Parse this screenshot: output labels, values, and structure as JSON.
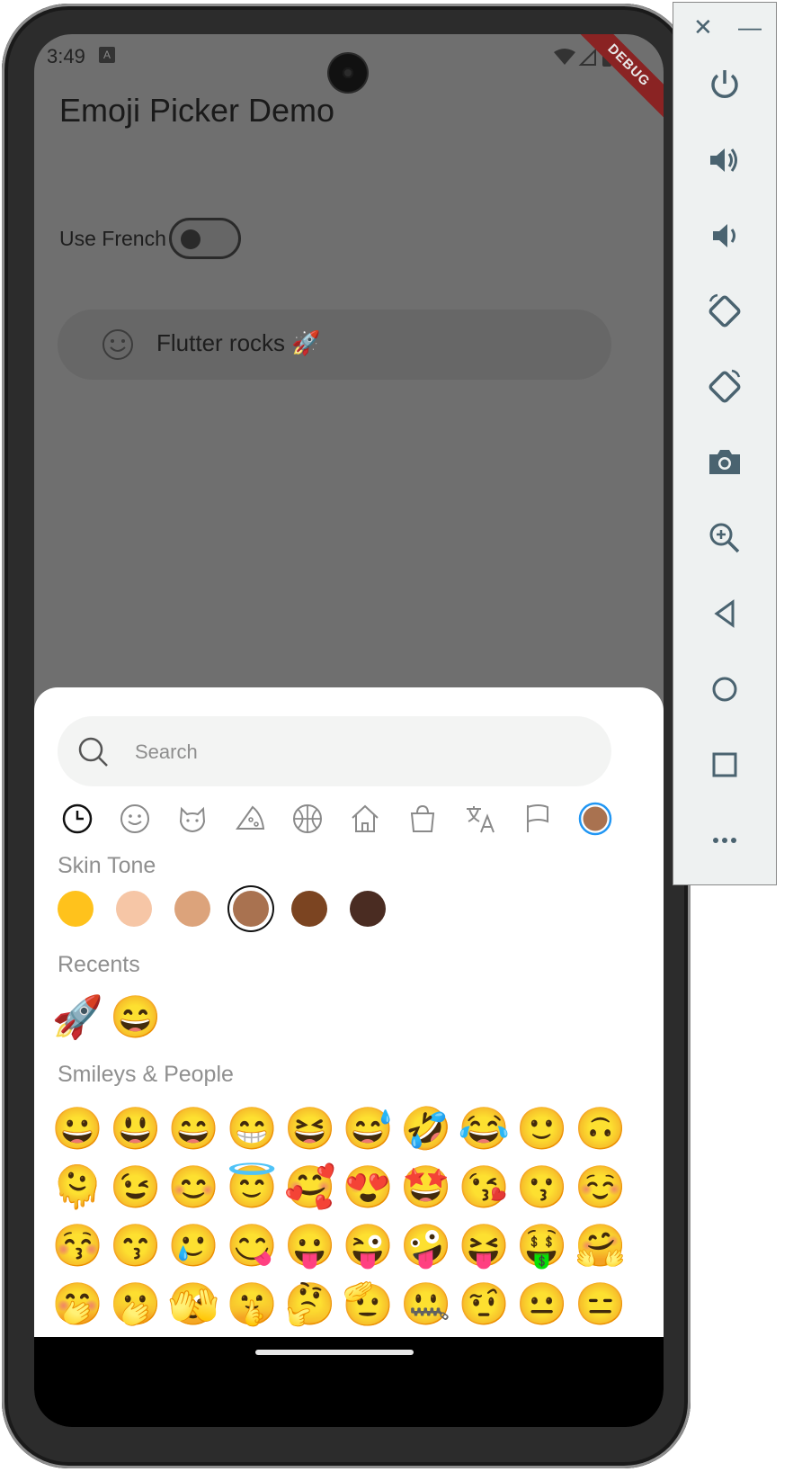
{
  "status": {
    "time": "3:49",
    "debug_label": "DEBUG"
  },
  "app": {
    "title": "Emoji Picker Demo",
    "french_label": "Use French",
    "text_value": "Flutter rocks 🚀"
  },
  "picker": {
    "search_placeholder": "Search",
    "categories": [
      "recent-icon",
      "smiley-icon",
      "animal-icon",
      "food-icon",
      "activity-icon",
      "travel-icon",
      "objects-icon",
      "symbols-icon",
      "flags-icon",
      "skin-tone-selected"
    ],
    "skin_tone_label": "Skin Tone",
    "skin_tones": [
      "#ffc21c",
      "#f6c6a6",
      "#dca37b",
      "#a97250",
      "#7b4421",
      "#4a2c22"
    ],
    "selected_tone_index": 3,
    "recents_label": "Recents",
    "recents": [
      "🚀",
      "😄"
    ],
    "smileys_label": "Smileys & People",
    "smileys": [
      [
        "😀",
        "😃",
        "😄",
        "😁",
        "😆",
        "😅",
        "🤣",
        "😂",
        "🙂",
        "🙃"
      ],
      [
        "🫠",
        "😉",
        "😊",
        "😇",
        "🥰",
        "😍",
        "🤩",
        "😘",
        "😗",
        "☺️"
      ],
      [
        "😚",
        "😙",
        "🥲",
        "😋",
        "😛",
        "😜",
        "🤪",
        "😝",
        "🤑",
        "🤗"
      ],
      [
        "🤭",
        "🫢",
        "🫣",
        "🤫",
        "🤔",
        "🫡",
        "🤐",
        "🤨",
        "😐",
        "😑"
      ]
    ],
    "accent": "#2196f3"
  },
  "emulator": {
    "close_glyph": "✕",
    "minimize_glyph": "—",
    "buttons": [
      "power-icon",
      "volume-up-icon",
      "volume-down-icon",
      "rotate-left-icon",
      "rotate-right-icon",
      "camera-icon",
      "zoom-icon",
      "back-icon",
      "home-icon",
      "overview-icon",
      "more-icon"
    ]
  }
}
